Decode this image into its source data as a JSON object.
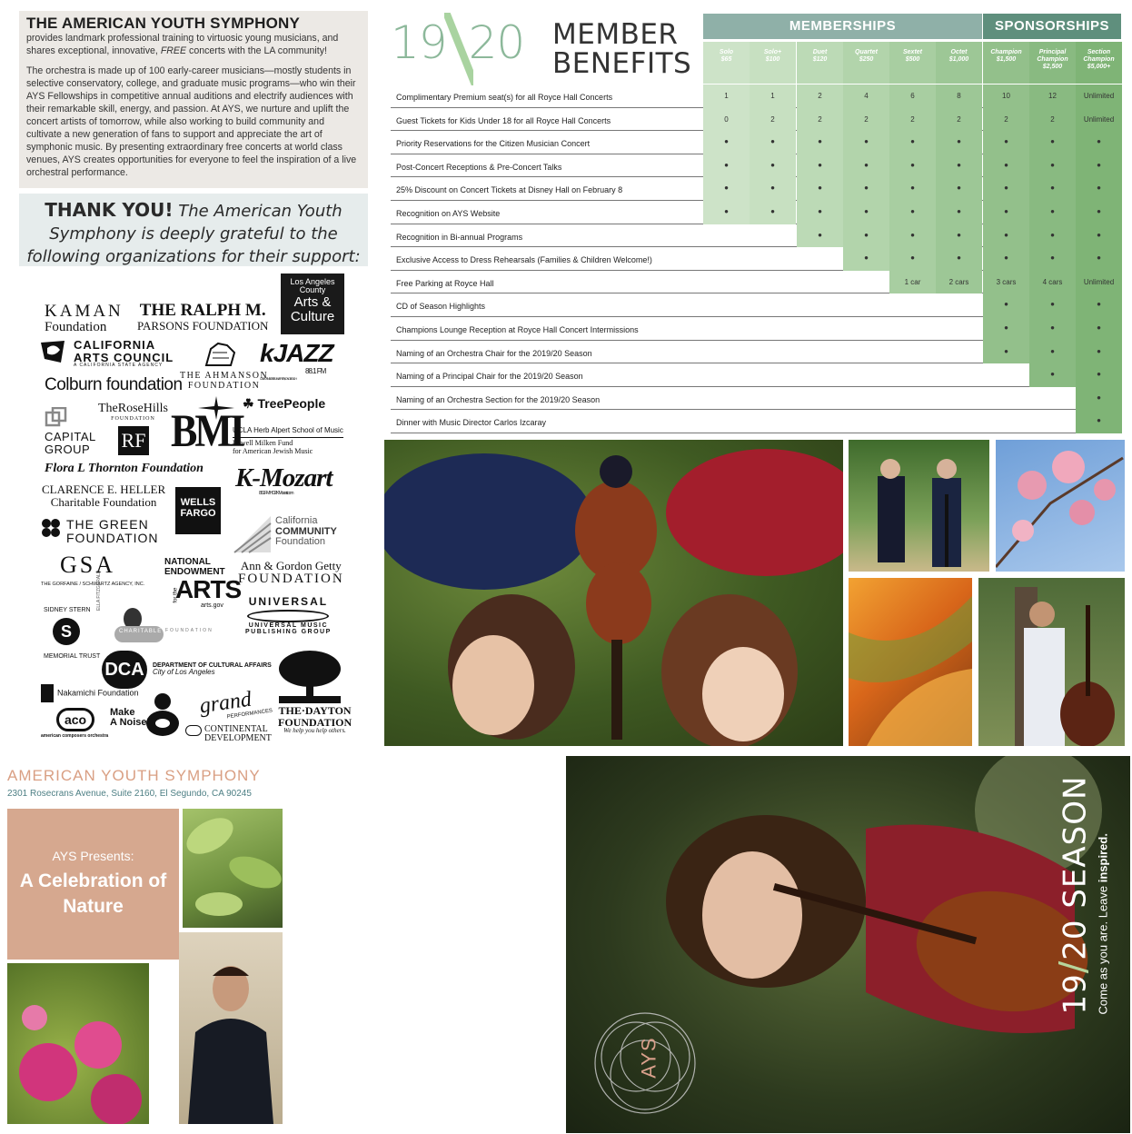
{
  "intro": {
    "heading": "THE AMERICAN YOUTH SYMPHONY",
    "lead_before": "provides landmark professional training to virtuosic young musicians, and shares exceptional, innovative, ",
    "lead_emph": "FREE",
    "lead_after": " concerts with the LA community!",
    "body": "The orchestra is made up of 100 early-career musicians—mostly students in selective conservatory, college, and graduate music programs—who win their AYS Fellowships in competitive annual auditions and electrify audiences with their remarkable skill, energy, and passion. At AYS, we nurture and uplift the concert artists of tomorrow, while also working to build community and cultivate a new generation of fans to support and appreciate the art of symphonic music. By presenting extraordinary free concerts at world class venues, AYS creates opportunities for everyone to feel the inspiration of a live orchestral performance."
  },
  "thanks": {
    "bold": "THANK YOU!",
    "text": " The American Youth Symphony is deeply grateful to the following organizations for their support:"
  },
  "logos": {
    "kaman": "KAMAN",
    "kaman2": "Foundation",
    "parsons1": "THE RALPH M.",
    "parsons2": "PARSONS FOUNDATION",
    "lac1": "Los Angeles",
    "lac2": "County",
    "lac3": "Arts &",
    "lac4": "Culture",
    "cac1": "CALIFORNIA",
    "cac2": "ARTS COUNCIL",
    "cac3": "A CALIFORNIA STATE AGENCY",
    "kjazz": "kJAZZ",
    "kjazz2": "88.1 FM",
    "kjazz3": "CALIFORNIA STATE UNIVERSITY, LONG BEACH",
    "colburn": "Colburn foundation",
    "ahmanson1": "THE AHMANSON",
    "ahmanson2": "FOUNDATION",
    "treepeople": "TreePeople",
    "capital1": "CAPITAL",
    "capital2": "GROUP",
    "rosehills1": "TheRoseHills",
    "rosehills2": "FOUNDATION",
    "bmi": "BMI",
    "ucla1": "UCLA Herb Alpert School of Music",
    "ucla2": "Lowell Milken Fund",
    "ucla3": "for American Jewish Music",
    "thornton": "Flora L Thornton Foundation",
    "kmozart": "K-Mozart",
    "kmozart2": "88.1 FM HD2    KMozart.com",
    "heller1": "CLARENCE E. HELLER",
    "heller2": "Charitable Foundation",
    "wells1": "WELLS",
    "wells2": "FARGO",
    "ccf1": "California",
    "ccf2": "COMMUNITY",
    "ccf3": "Foundation",
    "green1": "THE GREEN",
    "green2": "FOUNDATION",
    "gsa": "GSA",
    "gsa2": "THE GORFAINE / SCHWARTZ AGENCY, INC.",
    "nea1": "NATIONAL",
    "nea2": "ENDOWMENT",
    "nea3": "for the",
    "nea4": "ARTS",
    "nea5": "arts.gov",
    "getty1": "Ann & Gordon Getty",
    "getty2": "FOUNDATION",
    "stern1": "SIDNEY STERN",
    "stern2": "MEMORIAL TRUST",
    "fitzgerald": "ELLA FITZGERALD",
    "fitzgerald2": "CHARITABLE",
    "fitzgerald3": "FOUNDATION",
    "universal1": "UNIVERSAL",
    "universal2": "UNIVERSAL MUSIC",
    "universal3": "PUBLISHING GROUP",
    "dca": "DCA",
    "dca2": "DEPARTMENT OF CULTURAL AFFAIRS",
    "dca3": "City of Los Angeles",
    "nakamichi": "Nakamichi Foundation",
    "aco": "aco",
    "aco2": "american composers orchestra",
    "makenoise1": "Make",
    "makenoise2": "A Noise",
    "grand1": "grand",
    "grand2": "PERFORMANCES",
    "continental1": "CONTINENTAL",
    "continental2": "DEVELOPMENT",
    "dayton1": "THE·DAYTON",
    "dayton2": "FOUNDATION",
    "dayton3": "We help you help others."
  },
  "benefits": {
    "year1": "19",
    "year2": "20",
    "title1": "MEMBER",
    "title2": "BENEFITS",
    "group_memberships": "MEMBERSHIPS",
    "group_sponsorships": "SPONSORSHIPS",
    "tiers": [
      {
        "name": "Solo",
        "price": "$65",
        "color": "#cde3c8"
      },
      {
        "name": "Solo+",
        "price": "$100",
        "color": "#c7e0c1"
      },
      {
        "name": "Duet",
        "price": "$120",
        "color": "#bcdab6"
      },
      {
        "name": "Quartet",
        "price": "$250",
        "color": "#b2d4ab"
      },
      {
        "name": "Sextet",
        "price": "$500",
        "color": "#a8cea1"
      },
      {
        "name": "Octet",
        "price": "$1,000",
        "color": "#9dc796"
      },
      {
        "name": "Champion",
        "price": "$1,500",
        "color": "#93c08b"
      },
      {
        "name": "Principal Champion",
        "price": "$2,500",
        "color": "#89ba81"
      },
      {
        "name": "Section Champion",
        "price": "$5,000+",
        "color": "#7fb476"
      }
    ],
    "rows": [
      {
        "label": "Complimentary Premium seat(s) for all Royce Hall Concerts",
        "cells": [
          "1",
          "1",
          "2",
          "4",
          "6",
          "8",
          "10",
          "12",
          "Unlimited"
        ]
      },
      {
        "label": "Guest Tickets for Kids Under 18 for all Royce Hall Concerts",
        "cells": [
          "0",
          "2",
          "2",
          "2",
          "2",
          "2",
          "2",
          "2",
          "Unlimited"
        ]
      },
      {
        "label": "Priority Reservations for the Citizen Musician Concert",
        "cells": [
          "•",
          "•",
          "•",
          "•",
          "•",
          "•",
          "•",
          "•",
          "•"
        ]
      },
      {
        "label": "Post-Concert Receptions & Pre-Concert Talks",
        "cells": [
          "•",
          "•",
          "•",
          "•",
          "•",
          "•",
          "•",
          "•",
          "•"
        ]
      },
      {
        "label": "25% Discount on Concert Tickets at Disney Hall on February 8",
        "cells": [
          "•",
          "•",
          "•",
          "•",
          "•",
          "•",
          "•",
          "•",
          "•"
        ]
      },
      {
        "label": "Recognition on AYS Website",
        "cells": [
          "•",
          "•",
          "•",
          "•",
          "•",
          "•",
          "•",
          "•",
          "•"
        ]
      },
      {
        "label": "Recognition in Bi-annual Programs",
        "cells": [
          "",
          "",
          "•",
          "•",
          "•",
          "•",
          "•",
          "•",
          "•"
        ]
      },
      {
        "label": "Exclusive Access to Dress Rehearsals (Families & Children Welcome!)",
        "cells": [
          "",
          "",
          "",
          "•",
          "•",
          "•",
          "•",
          "•",
          "•"
        ]
      },
      {
        "label": "Free Parking at Royce Hall",
        "cells": [
          "",
          "",
          "",
          "",
          "1 car",
          "2 cars",
          "3 cars",
          "4 cars",
          "Unlimited"
        ]
      },
      {
        "label": "CD of Season Highlights",
        "cells": [
          "",
          "",
          "",
          "",
          "",
          "",
          "•",
          "•",
          "•"
        ]
      },
      {
        "label": "Champions Lounge Reception at Royce Hall Concert Intermissions",
        "cells": [
          "",
          "",
          "",
          "",
          "",
          "",
          "•",
          "•",
          "•"
        ]
      },
      {
        "label": "Naming of an Orchestra Chair for the 2019/20 Season",
        "cells": [
          "",
          "",
          "",
          "",
          "",
          "",
          "•",
          "•",
          "•"
        ]
      },
      {
        "label": "Naming of a Principal Chair for the 2019/20 Season",
        "cells": [
          "",
          "",
          "",
          "",
          "",
          "",
          "",
          "•",
          "•"
        ]
      },
      {
        "label": "Naming of an Orchestra Section for the 2019/20 Season",
        "cells": [
          "",
          "",
          "",
          "",
          "",
          "",
          "",
          "",
          "•"
        ]
      },
      {
        "label": "Dinner with Music Director Carlos Izcaray",
        "cells": [
          "",
          "",
          "",
          "",
          "",
          "",
          "",
          "",
          "•"
        ]
      }
    ]
  },
  "mailer": {
    "org": "AMERICAN YOUTH SYMPHONY",
    "address": "2301 Rosecrans Avenue, Suite 2160, El Segundo, CA 90245",
    "presents": "AYS Presents:",
    "title": "A Celebration of Nature"
  },
  "cover": {
    "logo": "AYS",
    "season_year1": "19",
    "season_year2": "20",
    "season_word": " SEASON",
    "tagline_plain": "Come as you are. Leave ",
    "tagline_bold": "inspired."
  }
}
